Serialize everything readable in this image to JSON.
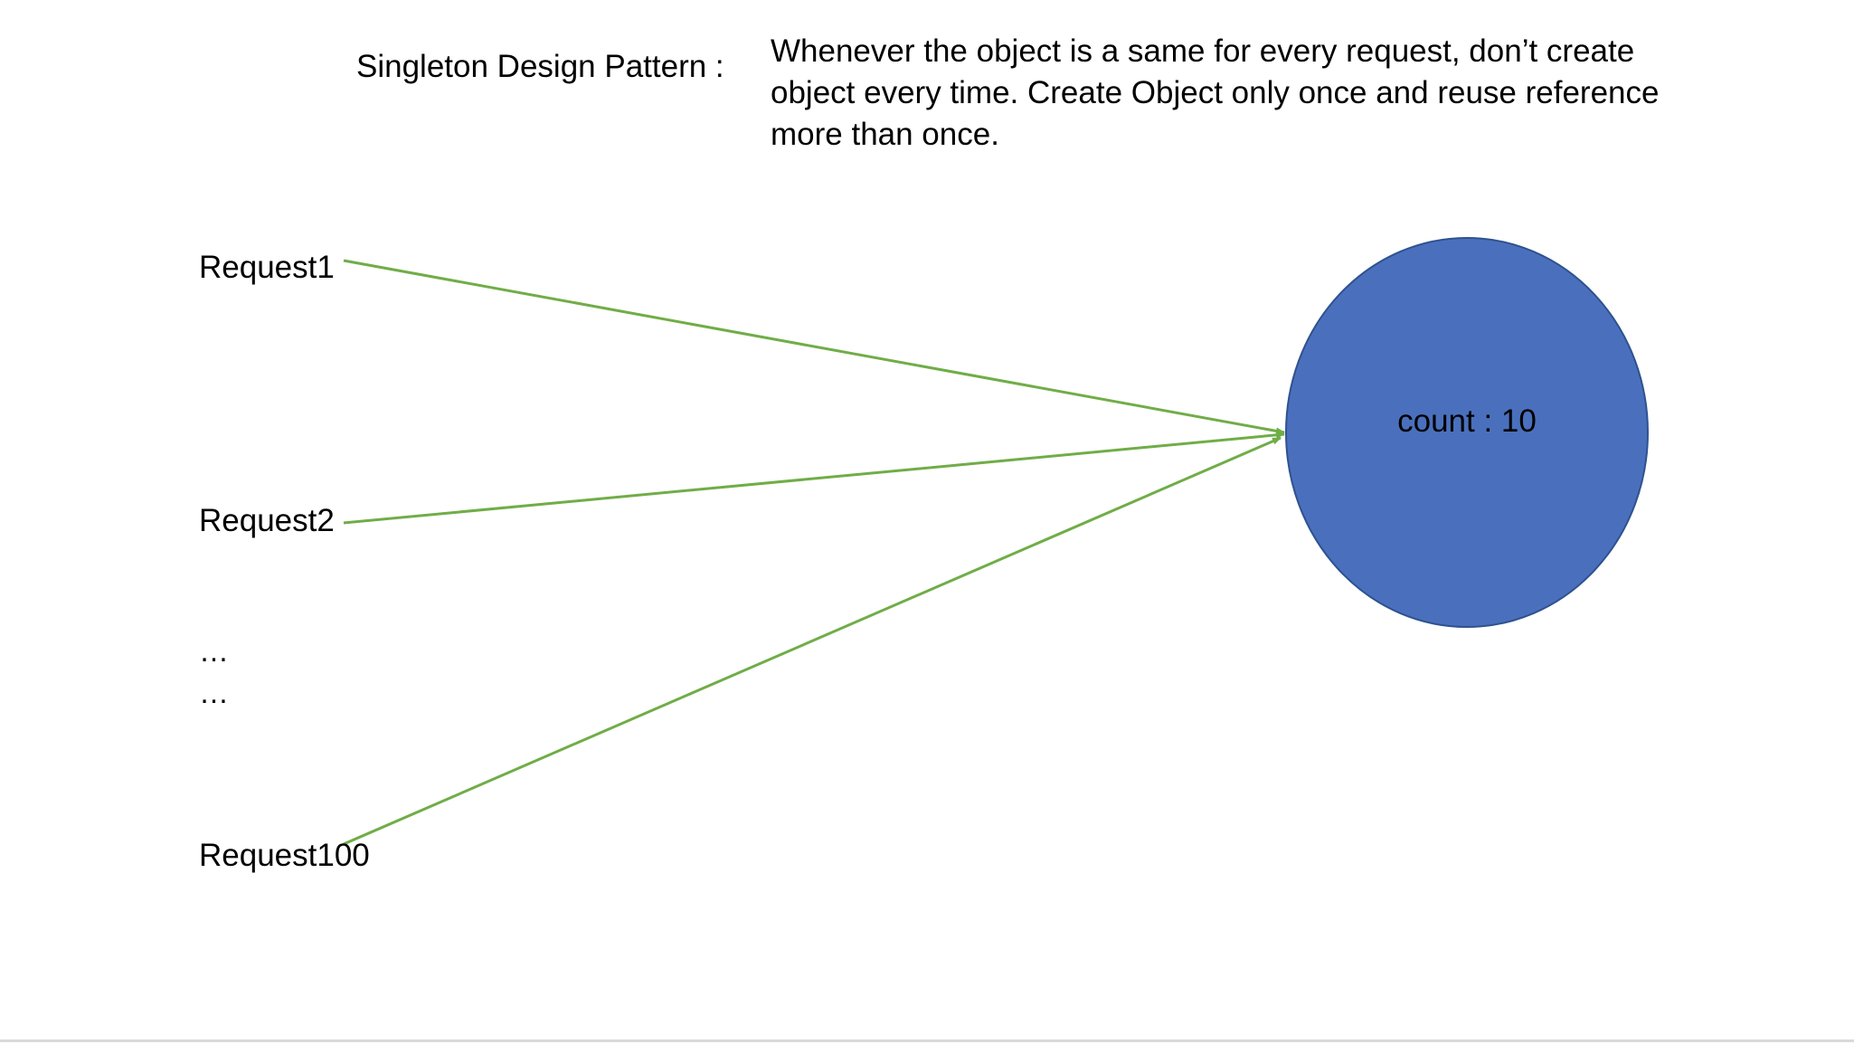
{
  "title": "Singleton Design Pattern :",
  "description": {
    "lines": [
      "Whenever the object is a same for every request, don’t create",
      "object every time. Create Object only once and reuse reference",
      "more than once."
    ]
  },
  "requests": [
    {
      "label": "Request1"
    },
    {
      "label": "Request2"
    },
    {
      "label": "Request100"
    }
  ],
  "ellipsis": [
    "…",
    "…"
  ],
  "object": {
    "label": "count : 10"
  },
  "colors": {
    "arrow": "#70ad47",
    "circle_fill": "#4a70bd",
    "circle_stroke": "#2f528f"
  }
}
